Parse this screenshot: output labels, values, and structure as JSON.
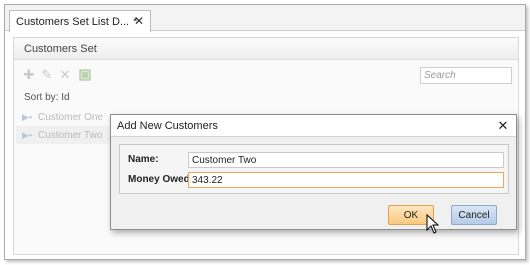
{
  "tab": {
    "title": "Customers Set List D...",
    "modified_marker": "*"
  },
  "panel": {
    "title": "Customers Set"
  },
  "toolbar": {
    "search_placeholder": "Search"
  },
  "list": {
    "sort_label": "Sort by: Id",
    "items": [
      {
        "label": "Customer One"
      },
      {
        "label": "Customer Two"
      }
    ]
  },
  "dialog": {
    "title": "Add New Customers",
    "name_label": "Name:",
    "name_value": "Customer Two",
    "money_label": "Money Owed:",
    "money_value": "343.22",
    "ok_label": "OK",
    "cancel_label": "Cancel"
  }
}
